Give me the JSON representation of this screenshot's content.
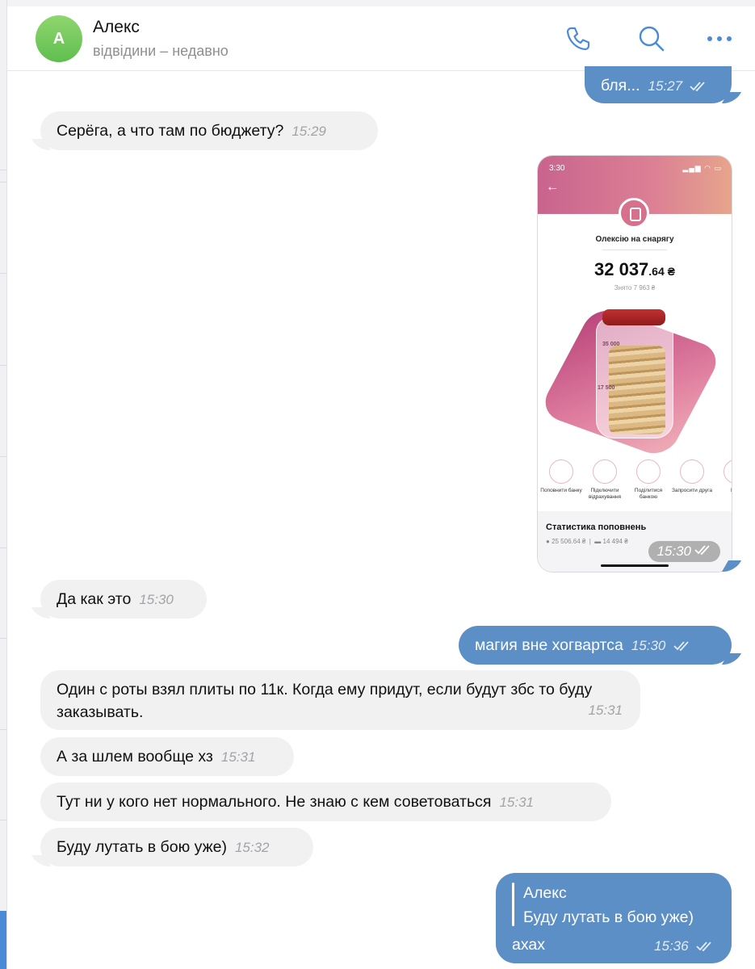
{
  "header": {
    "avatar_letter": "А",
    "contact_name": "Алекс",
    "contact_status": "відвідини – недавно",
    "icons": [
      "phone-icon",
      "search-icon",
      "more-icon"
    ],
    "accent_color": "#4a8ad6"
  },
  "messages": [
    {
      "id": "m1",
      "dir": "out",
      "text": "бля...",
      "time": "15:27",
      "read": true
    },
    {
      "id": "m2",
      "dir": "in",
      "text": "Серёга, а что там по бюджету?",
      "time": "15:29"
    },
    {
      "id": "m3",
      "dir": "out",
      "type": "photo",
      "time": "15:30",
      "read": true,
      "screenshot": {
        "status_time": "3:30",
        "jar_title": "Олексію на снарягу",
        "amount_main": "32 037",
        "amount_cents": ".64 ₴",
        "withdrawn": "Знято 7 963 ₴",
        "scale_top": "35 000",
        "scale_mid": "17 500",
        "actions": [
          "Поповнити банку",
          "Підключити відрахування",
          "Поділитися банкою",
          "Запросити друга",
          "Пер"
        ],
        "stats_title": "Статистика поповнень",
        "stats_row_1": "25 506.64 ₴",
        "stats_row_2": "14 494 ₴"
      }
    },
    {
      "id": "m4",
      "dir": "in",
      "text": "Да как это",
      "time": "15:30"
    },
    {
      "id": "m5",
      "dir": "out",
      "text": "магия вне хогвартса",
      "time": "15:30",
      "read": true
    },
    {
      "id": "m6",
      "dir": "in",
      "text": "Один с роты взял плиты по 11к. Когда ему придут, если будут збс то буду заказывать.",
      "time": "15:31"
    },
    {
      "id": "m7",
      "dir": "in",
      "text": "А за шлем вообще хз",
      "time": "15:31"
    },
    {
      "id": "m8",
      "dir": "in",
      "text": "Тут ни у кого нет нормального. Не знаю с кем советоваться",
      "time": "15:31"
    },
    {
      "id": "m9",
      "dir": "in",
      "text": "Буду лутать в бою уже)",
      "time": "15:32"
    },
    {
      "id": "m10",
      "dir": "out",
      "reply_to_name": "Алекс",
      "reply_to_text": "Буду лутать в бою уже)",
      "text": "ахах",
      "time": "15:36",
      "read": true
    }
  ]
}
